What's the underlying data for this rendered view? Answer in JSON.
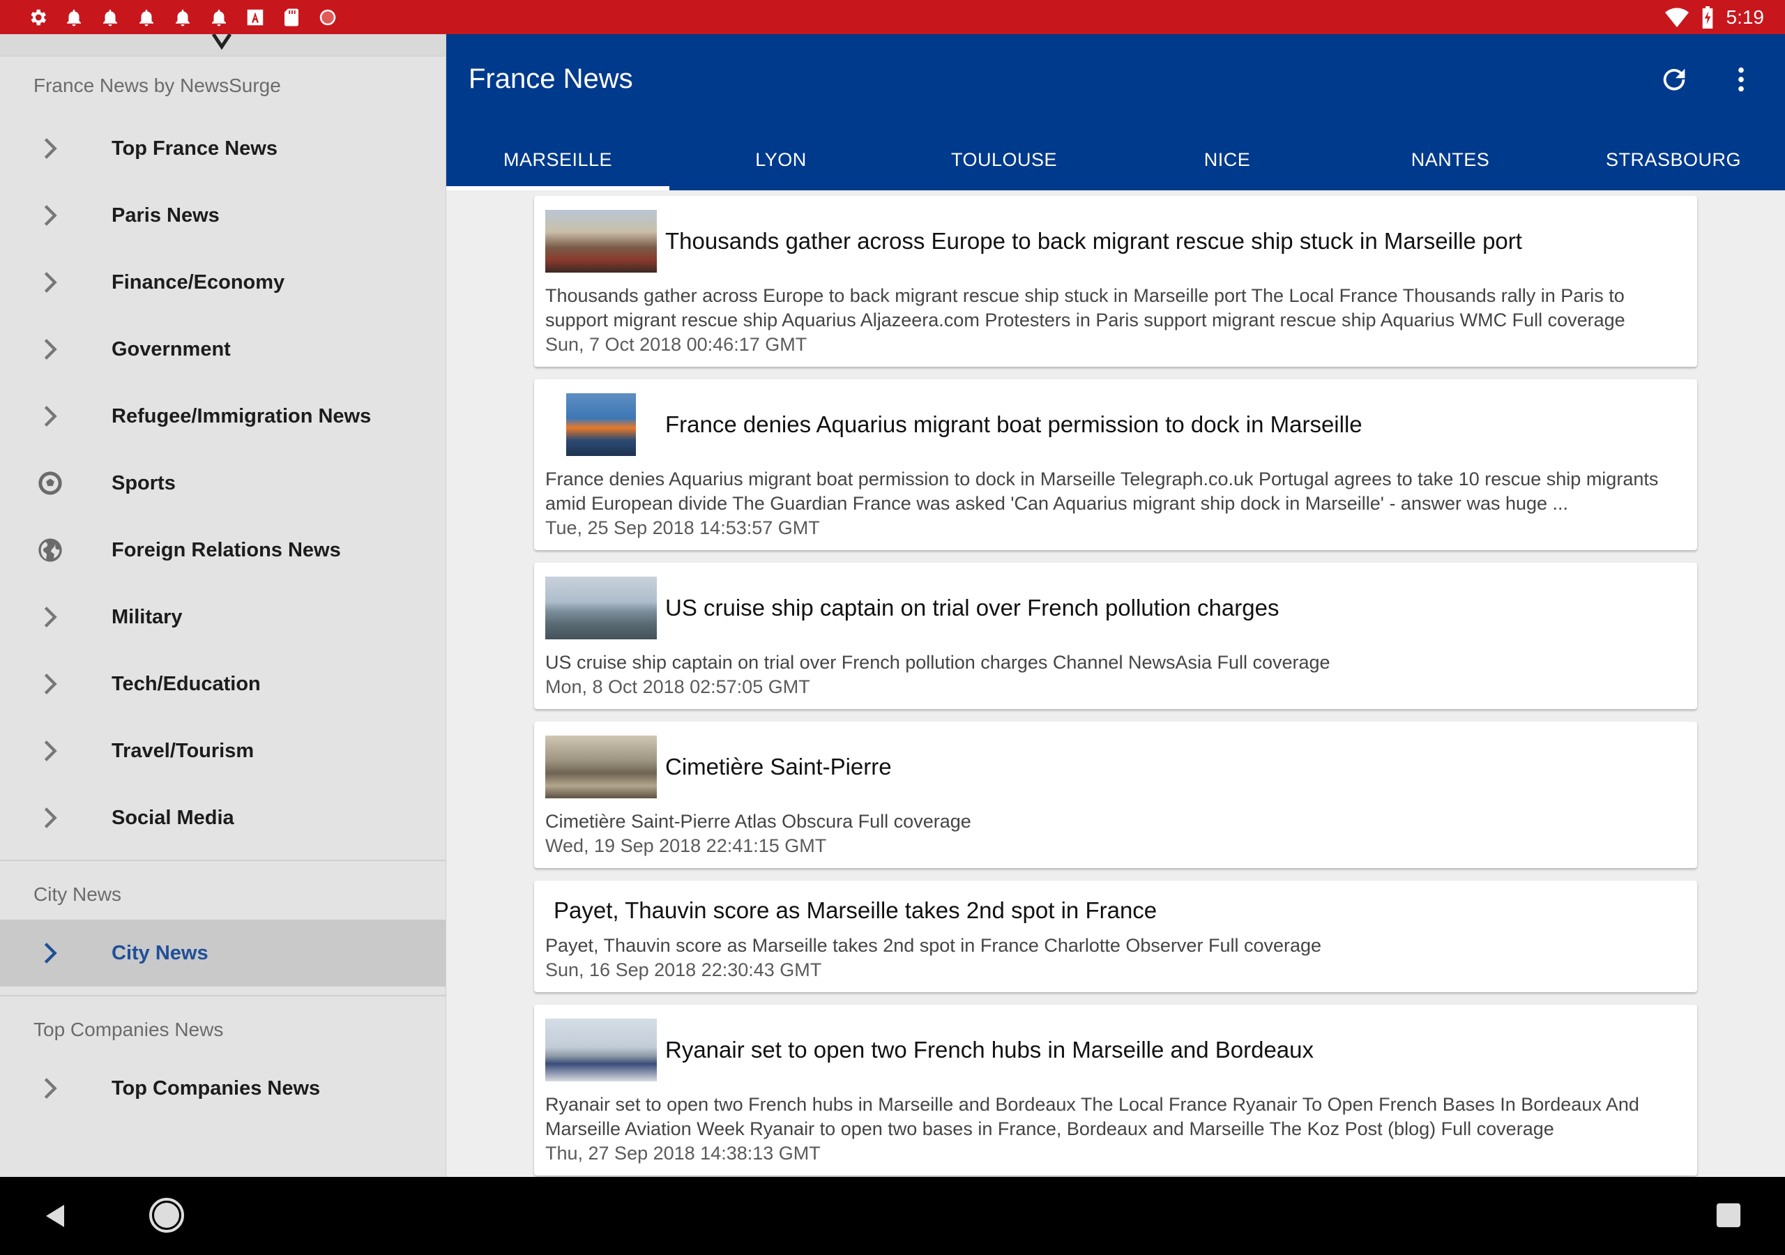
{
  "status": {
    "time": "5:19",
    "icons": [
      "gear-icon",
      "bell-icon",
      "bell-icon",
      "bell-icon",
      "bell-icon",
      "bell-icon",
      "font-a-icon",
      "sd-card-icon",
      "record-icon"
    ]
  },
  "drawer": {
    "section_main": "France News by NewsSurge",
    "items": [
      {
        "label": "Top France News",
        "icon": "chevron-right-icon"
      },
      {
        "label": "Paris News",
        "icon": "chevron-right-icon"
      },
      {
        "label": "Finance/Economy",
        "icon": "chevron-right-icon"
      },
      {
        "label": "Government",
        "icon": "chevron-right-icon"
      },
      {
        "label": "Refugee/Immigration News",
        "icon": "chevron-right-icon"
      },
      {
        "label": "Sports",
        "icon": "soccer-ball-icon"
      },
      {
        "label": "Foreign Relations News",
        "icon": "globe-icon"
      },
      {
        "label": "Military",
        "icon": "chevron-right-icon"
      },
      {
        "label": "Tech/Education",
        "icon": "chevron-right-icon"
      },
      {
        "label": "Travel/Tourism",
        "icon": "chevron-right-icon"
      },
      {
        "label": "Social Media",
        "icon": "chevron-right-icon"
      }
    ],
    "section_city": "City News",
    "city_item": "City News",
    "section_companies": "Top Companies News",
    "companies_item": "Top Companies News"
  },
  "appbar": {
    "title": "France News",
    "tabs": [
      "MARSEILLE",
      "LYON",
      "TOULOUSE",
      "NICE",
      "NANTES",
      "STRASBOURG"
    ],
    "selected_tab": "MARSEILLE"
  },
  "articles": [
    {
      "title": "Thousands gather across Europe to back migrant rescue ship stuck in Marseille port",
      "body": "Thousands gather across Europe to back migrant rescue ship stuck in Marseille port  The Local France  Thousands rally in Paris to support migrant rescue ship Aquarius  Aljazeera.com  Protesters in Paris support migrant rescue ship Aquarius  WMC  Full coverage",
      "date": "Sun, 7 Oct 2018 00:46:17 GMT"
    },
    {
      "title": "France denies Aquarius migrant boat permission to dock in Marseille",
      "body": "France denies Aquarius migrant boat permission to dock in Marseille  Telegraph.co.uk  Portugal agrees to take 10 rescue ship migrants amid European divide  The Guardian  France was asked 'Can Aquarius migrant ship dock in Marseille' - answer was huge ...",
      "date": "Tue, 25 Sep 2018 14:53:57 GMT"
    },
    {
      "title": "US cruise ship captain on trial over French pollution charges",
      "body": "US cruise ship captain on trial over French pollution charges  Channel NewsAsia  Full coverage",
      "date": "Mon, 8 Oct 2018 02:57:05 GMT"
    },
    {
      "title": "Cimetière Saint-Pierre",
      "body": "Cimetière Saint-Pierre  Atlas Obscura  Full coverage",
      "date": "Wed, 19 Sep 2018 22:41:15 GMT"
    },
    {
      "title": "Payet, Thauvin score as Marseille takes 2nd spot in France",
      "body": "Payet, Thauvin score as Marseille takes 2nd spot in France  Charlotte Observer  Full coverage",
      "date": "Sun, 16 Sep 2018 22:30:43 GMT"
    },
    {
      "title": "Ryanair set to open two French hubs in Marseille and Bordeaux",
      "body": "Ryanair set to open two French hubs in Marseille and Bordeaux  The Local France  Ryanair To Open French Bases In Bordeaux And Marseille  Aviation Week  Ryanair to open two bases in France, Bordeaux and Marseille  The Koz Post (blog)  Full coverage",
      "date": "Thu, 27 Sep 2018 14:38:13 GMT"
    }
  ],
  "colors": {
    "status_bar": "#c8161d",
    "app_bar": "#003a8c",
    "drawer_bg": "#e3e3e3",
    "active_item": "#1f4f99"
  }
}
